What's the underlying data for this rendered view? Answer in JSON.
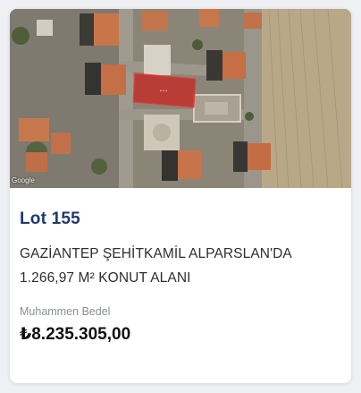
{
  "lot": {
    "title": "Lot 155",
    "description": "GAZİANTEP ŞEHİTKAMİL ALPARSLAN'DA 1.266,97 M² KONUT ALANI",
    "price_label": "Muhammen Bedel",
    "price_value": "₺8.235.305,00"
  },
  "map": {
    "attribution": "Google",
    "highlight_color": "#c0302a"
  }
}
